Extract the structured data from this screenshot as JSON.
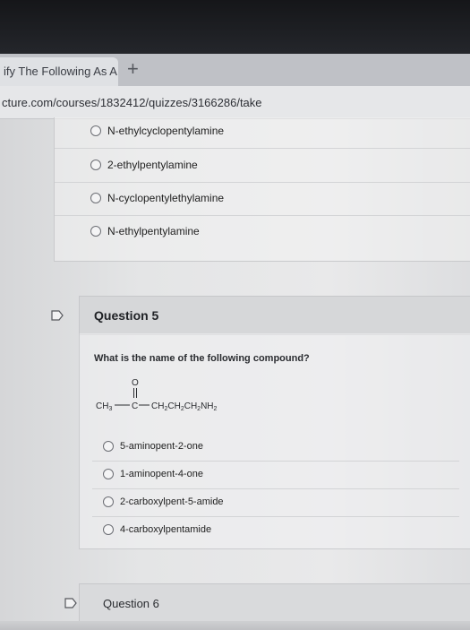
{
  "browser": {
    "tab_title": "ify The Following As A",
    "new_tab_symbol": "+",
    "url": "cture.com/courses/1832412/quizzes/3166286/take"
  },
  "previous_question": {
    "options": [
      "N-ethylcyclopentylamine",
      "2-ethylpentylamine",
      "N-cyclopentylethylamine",
      "N-ethylpentylamine"
    ]
  },
  "question5": {
    "title": "Question 5",
    "prompt": "What is the name of the following compound?",
    "structure": {
      "oxygen": "O",
      "left_group": "CH3",
      "carbon": "C",
      "right_chain": "CH2CH2CH2NH2"
    },
    "options": [
      "5-aminopent-2-one",
      "1-aminopent-4-one",
      "2-carboxylpent-5-amide",
      "4-carboxylpentamide"
    ]
  },
  "question6": {
    "title": "Question 6"
  }
}
